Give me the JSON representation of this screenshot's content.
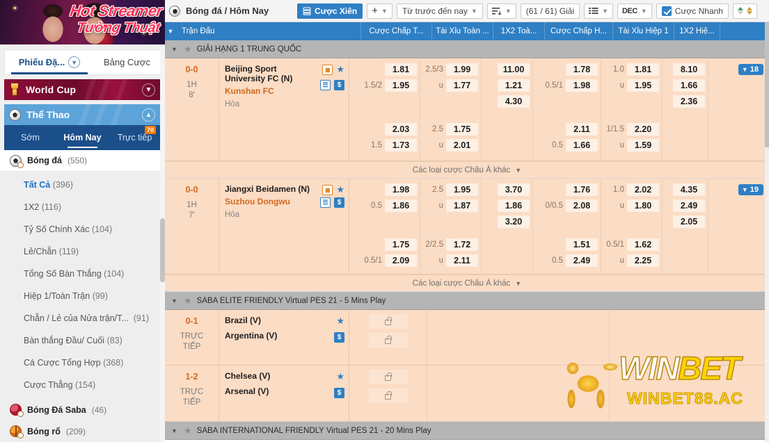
{
  "sidebar": {
    "promo": {
      "line1": "Hot Streamer",
      "line2": "Tường Thuật"
    },
    "tabs": {
      "betslip": "Phiếu Đặ...",
      "betboard": "Bảng Cược"
    },
    "world_cup": {
      "label": "World Cup",
      "icon": "trophy-icon"
    },
    "sport_header": {
      "label": "Thể Thao",
      "icon": "football-icon"
    },
    "subtabs": [
      {
        "label": "Sớm",
        "active": false,
        "badge": ""
      },
      {
        "label": "Hôm Nay",
        "active": true,
        "badge": ""
      },
      {
        "label": "Trực tiếp",
        "active": false,
        "badge": "70"
      }
    ],
    "sports": [
      {
        "label": "Bóng đá",
        "count": "(550)",
        "icon": "football-icon"
      },
      {
        "label": "Bóng Đá Saba",
        "count": "(46)",
        "icon": "saba-ball-icon"
      },
      {
        "label": "Bóng rổ",
        "count": "(209)",
        "icon": "basketball-icon"
      }
    ],
    "menu": [
      {
        "label": "Tất Cả",
        "count": "(396)",
        "active": true
      },
      {
        "label": "1X2",
        "count": "(116)",
        "active": false
      },
      {
        "label": "Tỷ Số Chính Xác",
        "count": "(104)",
        "active": false
      },
      {
        "label": "Lẻ/Chẵn",
        "count": "(119)",
        "active": false
      },
      {
        "label": "Tổng Số Bàn Thắng",
        "count": "(104)",
        "active": false
      },
      {
        "label": "Hiệp 1/Toàn Trận",
        "count": "(99)",
        "active": false
      },
      {
        "label": "Chẵn / Lẻ của Nửa trận/T...",
        "count": "(91)",
        "active": false
      },
      {
        "label": "Bàn thắng Đầu/ Cuối",
        "count": "(83)",
        "active": false
      },
      {
        "label": "Cá Cược Tổng Hợp",
        "count": "(368)",
        "active": false
      },
      {
        "label": "Cược Thẳng",
        "count": "(154)",
        "active": false
      }
    ]
  },
  "toolbar": {
    "title": "Bóng đá / Hôm Nay",
    "parlay_label": "Cược Xiên",
    "plus_label": "+",
    "period_label": "Từ trước đến nay",
    "sort_icon": "sort-icon",
    "leagues_label": "(61 / 61) Giải",
    "list_icon": "list-view-icon",
    "odds_format": "DEC",
    "quickbet_label": "Cược Nhanh",
    "updown_icon": "odds-updown-icon"
  },
  "table": {
    "header": {
      "match": "Trận Đấu",
      "columns": [
        "Cược Chấp T...",
        "Tài Xỉu Toàn ...",
        "1X2 Toà...",
        "Cược Chấp H...",
        "Tài Xỉu Hiệp 1",
        "1X2 Hiệ..."
      ]
    },
    "more_asian_label": "Các loại cược Châu Á khác"
  },
  "leagues": [
    {
      "name": "GIẢI HẠNG 1 TRUNG QUỐC",
      "matches": [
        {
          "score": "0-0",
          "period": "1H",
          "minute": "8'",
          "home": "Beijing Sport University FC (N)",
          "away": "Kunshan FC",
          "draw": "Hòa",
          "count_badge": "18",
          "icons_row1": [
            "stats-icon",
            "favorite-star-icon"
          ],
          "icons_row2": [
            "list-icon",
            "cashout-icon"
          ],
          "odds": {
            "ft_handicap": {
              "hcap": "1.5/2",
              "home": "1.81",
              "away": "1.95"
            },
            "ft_ou": {
              "line": "2.5/3",
              "over": "1.99",
              "under_marker": "u",
              "under": "1.77"
            },
            "ft_1x2": {
              "home": "11.00",
              "draw": "1.21",
              "away": "4.30"
            },
            "h1_handicap": {
              "hcap": "0.5/1",
              "home": "1.78",
              "away": "1.98"
            },
            "h1_ou": {
              "line": "1.0",
              "over": "1.81",
              "under_marker": "u",
              "under": "1.95"
            },
            "h1_1x2": {
              "home": "8.10",
              "draw": "1.66",
              "away": "2.36"
            },
            "ft_handicap2": {
              "hcap": "1.5",
              "home": "2.03",
              "away": "1.73"
            },
            "ft_ou2": {
              "line": "2.5",
              "over": "1.75",
              "under_marker": "u",
              "under": "2.01"
            },
            "h1_handicap2": {
              "hcap": "0.5",
              "home": "2.11",
              "away": "1.66"
            },
            "h1_ou2": {
              "line": "1/1.5",
              "over": "2.20",
              "under_marker": "u",
              "under": "1.59"
            }
          }
        },
        {
          "score": "0-0",
          "period": "1H",
          "minute": "7'",
          "home": "Jiangxi Beidamen (N)",
          "away": "Suzhou Dongwu",
          "draw": "Hòa",
          "count_badge": "19",
          "icons_row1": [
            "stats-icon",
            "favorite-star-icon"
          ],
          "icons_row2": [
            "list-icon",
            "cashout-icon"
          ],
          "odds": {
            "ft_handicap": {
              "hcap": "0.5",
              "home": "1.98",
              "away": "1.86"
            },
            "ft_ou": {
              "line": "2.5",
              "over": "1.95",
              "under_marker": "u",
              "under": "1.87"
            },
            "ft_1x2": {
              "home": "3.70",
              "draw": "1.86",
              "away": "3.20"
            },
            "h1_handicap": {
              "hcap": "0/0.5",
              "home": "1.76",
              "away": "2.08"
            },
            "h1_ou": {
              "line": "1.0",
              "over": "2.02",
              "under_marker": "u",
              "under": "1.80"
            },
            "h1_1x2": {
              "home": "4.35",
              "draw": "2.49",
              "away": "2.05"
            },
            "ft_handicap2": {
              "hcap": "0.5/1",
              "home": "1.75",
              "away": "2.09"
            },
            "ft_ou2": {
              "line": "2/2.5",
              "over": "1.72",
              "under_marker": "u",
              "under": "2.11"
            },
            "h1_handicap2": {
              "hcap": "0.5",
              "home": "1.51",
              "away": "2.49"
            },
            "h1_ou2": {
              "line": "0.5/1",
              "over": "1.62",
              "under_marker": "u",
              "under": "2.25"
            }
          }
        }
      ]
    },
    {
      "name": "SABA ELITE FRIENDLY Virtual PES 21 - 5 Mins Play",
      "virtual_matches": [
        {
          "score": "0-1",
          "status_l1": "TRỰC",
          "status_l2": "TIẾP",
          "home": "Brazil (V)",
          "away": "Argentina (V)",
          "locked": true
        },
        {
          "score": "1-2",
          "status_l1": "TRỰC",
          "status_l2": "TIẾP",
          "home": "Chelsea (V)",
          "away": "Arsenal (V)",
          "locked": true
        }
      ]
    },
    {
      "name": "SABA INTERNATIONAL FRIENDLY Virtual PES 21 - 20 Mins Play",
      "virtual_matches": []
    }
  ],
  "watermark": {
    "w1": "WIN",
    "w2": "BET",
    "sub": "WINBET88.AC"
  },
  "colors": {
    "accent": "#2f7fc4",
    "match_bg": "#fbdcc4",
    "away_team": "#d2691e",
    "league_bg": "#b5b5b5"
  }
}
